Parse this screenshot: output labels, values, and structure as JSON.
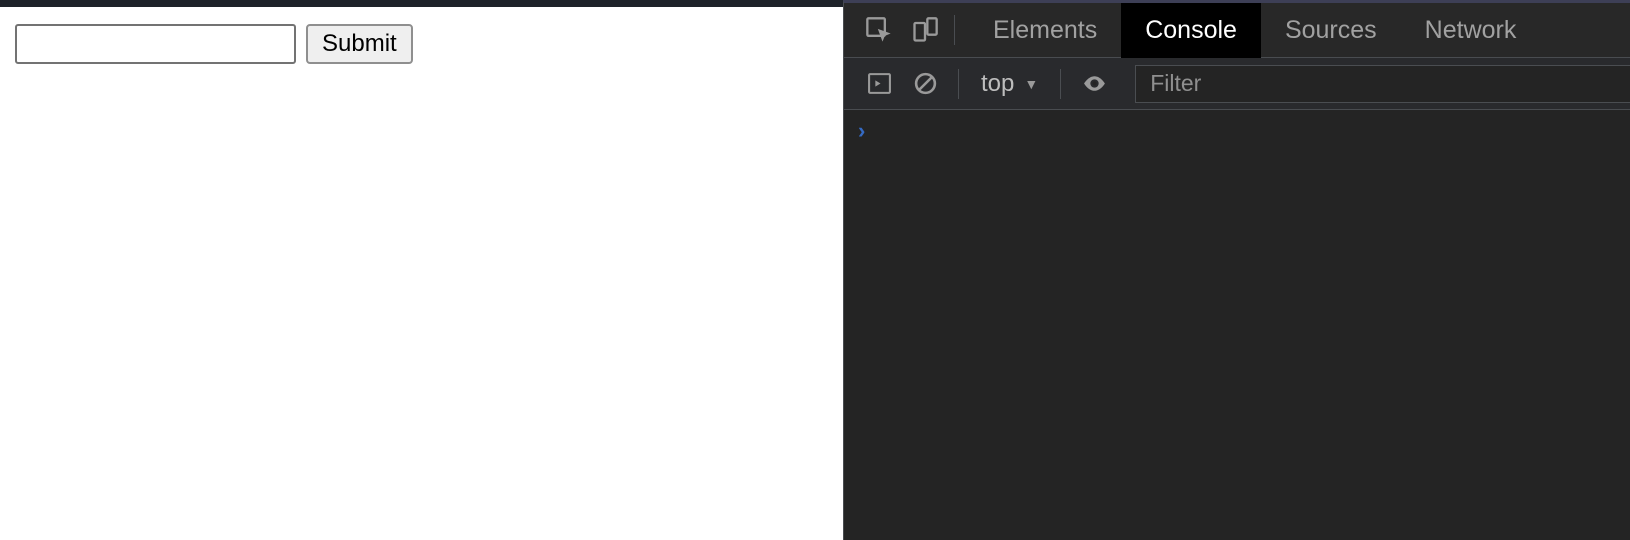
{
  "page": {
    "input_value": "",
    "submit_label": "Submit"
  },
  "devtools": {
    "tabs": {
      "elements": "Elements",
      "console": "Console",
      "sources": "Sources",
      "network": "Network"
    },
    "active_tab": "console",
    "toolbar": {
      "context_label": "top",
      "filter_placeholder": "Filter"
    },
    "console": {
      "prompt": "›",
      "input_value": ""
    }
  },
  "colors": {
    "devtools_bg": "#242424",
    "tab_inactive_text": "#a1a1a1",
    "tab_active_bg": "#000000",
    "prompt_blue": "#356ac3"
  }
}
